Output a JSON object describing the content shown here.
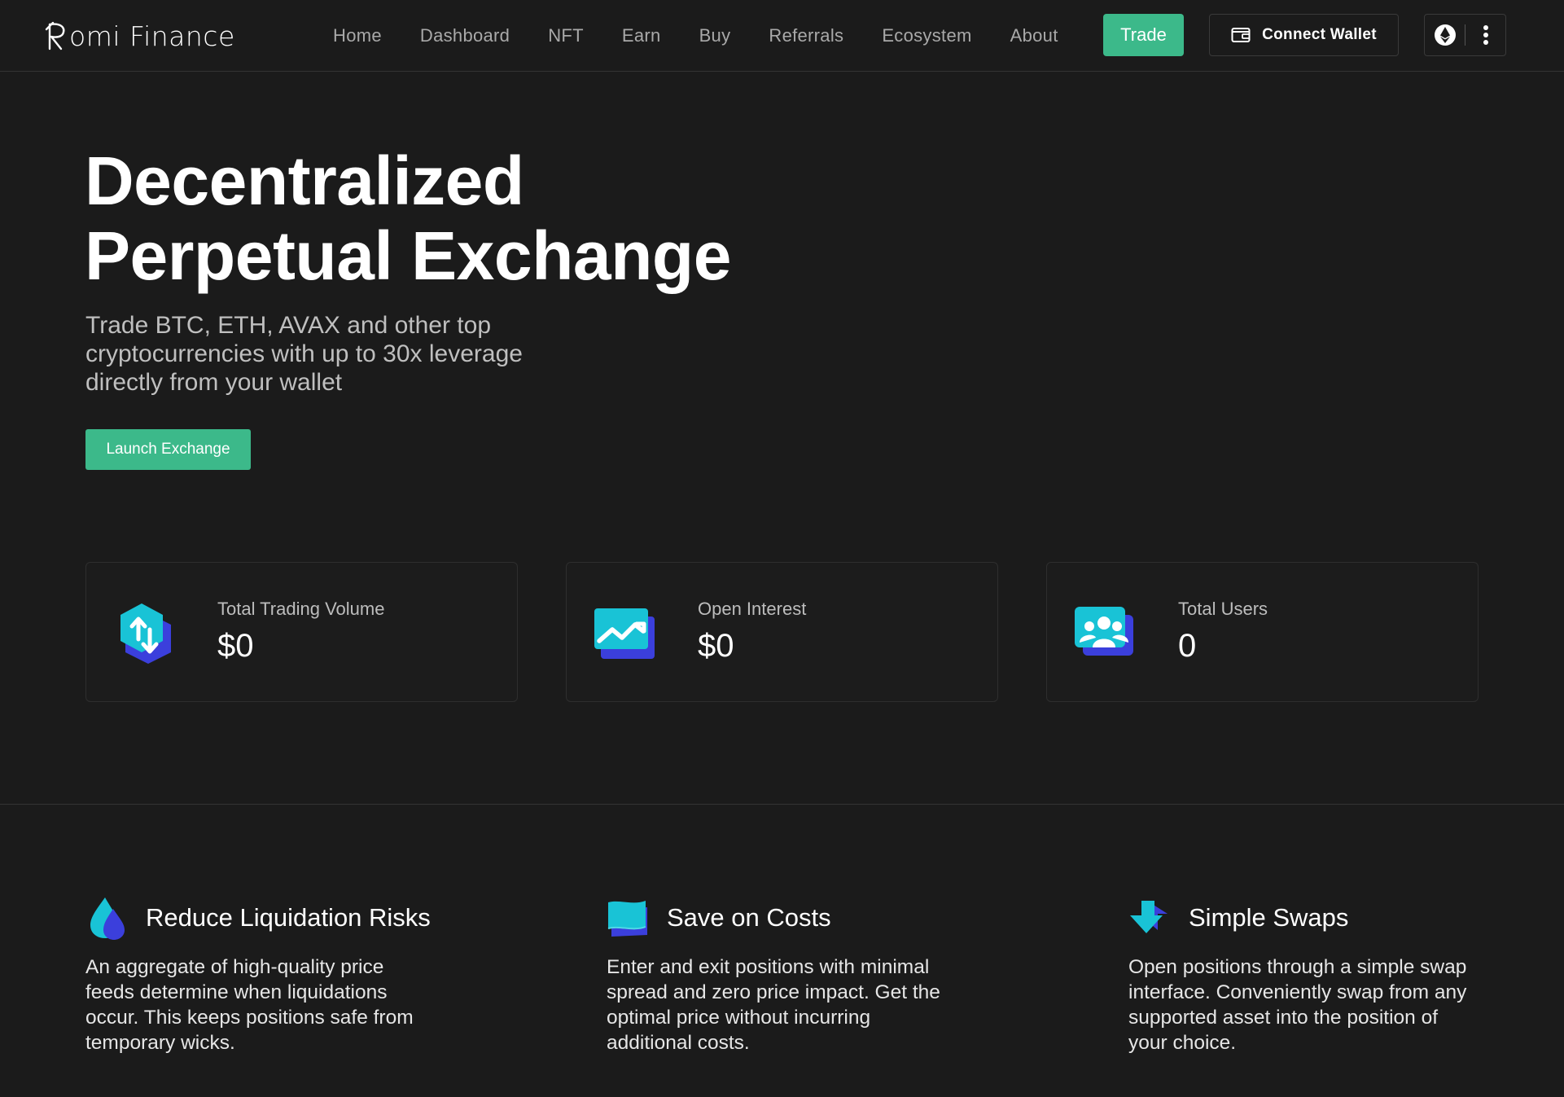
{
  "header": {
    "logo_text": "omi Finance",
    "nav": [
      {
        "label": "Home"
      },
      {
        "label": "Dashboard"
      },
      {
        "label": "NFT"
      },
      {
        "label": "Earn"
      },
      {
        "label": "Buy"
      },
      {
        "label": "Referrals"
      },
      {
        "label": "Ecosystem"
      },
      {
        "label": "About"
      }
    ],
    "trade_label": "Trade",
    "wallet_label": "Connect Wallet",
    "wallet_icon": "wallet-icon",
    "network_icon": "ethereum-icon",
    "menu_icon": "more-vertical-icon"
  },
  "hero": {
    "title_line1": "Decentralized",
    "title_line2": "Perpetual Exchange",
    "subtitle": "Trade BTC, ETH, AVAX and other top cryptocurrencies with up to 30x leverage directly from your wallet",
    "cta_label": "Launch Exchange"
  },
  "stats": [
    {
      "label": "Total Trading Volume",
      "value": "$0",
      "icon": "trading-volume-icon"
    },
    {
      "label": "Open Interest",
      "value": "$0",
      "icon": "open-interest-icon"
    },
    {
      "label": "Total Users",
      "value": "0",
      "icon": "users-icon"
    }
  ],
  "features": [
    {
      "title": "Reduce Liquidation Risks",
      "text": "An aggregate of high-quality price feeds determine when liquidations occur. This keeps positions safe from temporary wicks.",
      "icon": "droplet-icon"
    },
    {
      "title": "Save on Costs",
      "text": "Enter and exit positions with minimal spread and zero price impact. Get the optimal price without incurring additional costs.",
      "icon": "costs-icon"
    },
    {
      "title": "Simple Swaps",
      "text": "Open positions through a simple swap interface. Conveniently swap from any supported asset into the position of your choice.",
      "icon": "swap-icon"
    }
  ],
  "colors": {
    "background": "#1b1b1b",
    "accent": "#3cb98a",
    "icon_cyan": "#19c3d6",
    "icon_blue": "#3b3fdc"
  }
}
